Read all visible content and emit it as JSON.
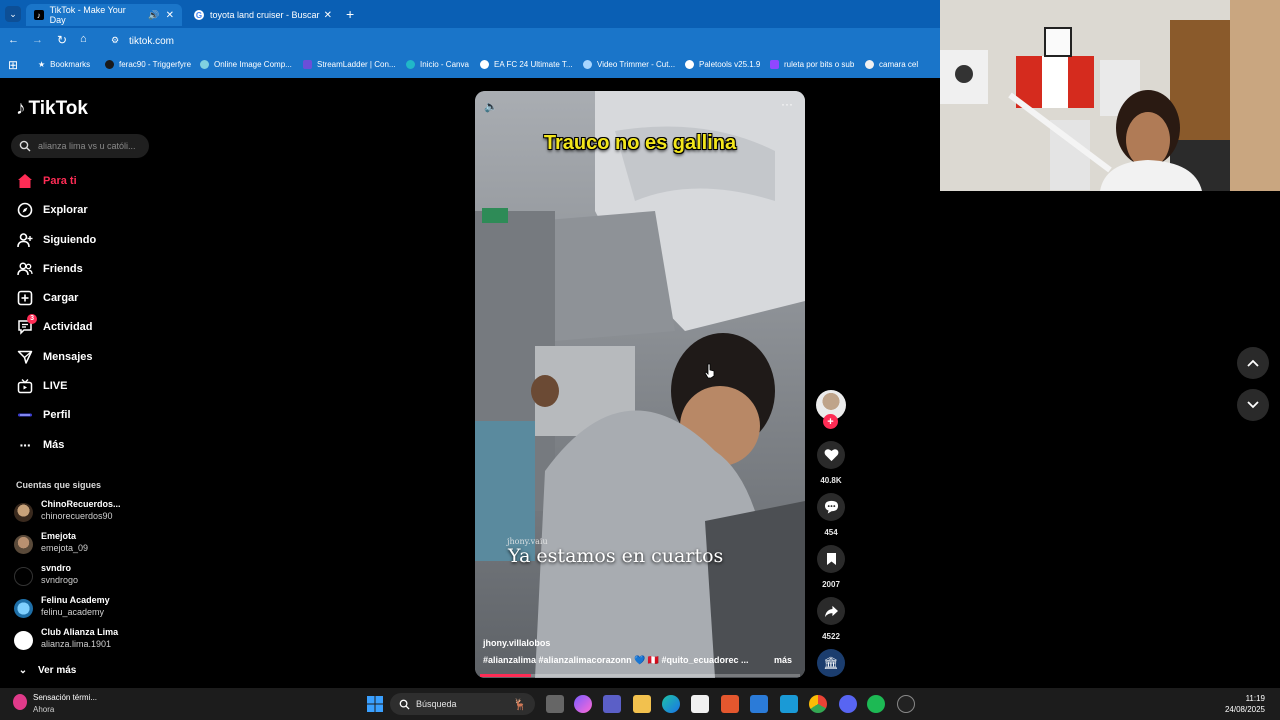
{
  "browser": {
    "tabs": [
      {
        "label": "TikTok - Make Your Day",
        "active": true
      },
      {
        "label": "toyota land cruiser - Buscar con",
        "active": false
      }
    ],
    "url": "tiktok.com",
    "bookmarks": [
      "Bookmarks",
      "ferac90 - Triggerfyre",
      "Online Image Comp...",
      "StreamLadder | Con...",
      "Inicio - Canva",
      "EA FC 24 Ultimate T...",
      "Video Trimmer - Cut...",
      "Paletools v25.1.9",
      "ruleta por bits o sub",
      "camara cel"
    ]
  },
  "sidebar": {
    "logo": "TikTok",
    "search_placeholder": "alianza lima vs u católi...",
    "nav": [
      {
        "label": "Para ti",
        "icon": "home-icon",
        "active": true
      },
      {
        "label": "Explorar",
        "icon": "compass-icon"
      },
      {
        "label": "Siguiendo",
        "icon": "following-icon"
      },
      {
        "label": "Friends",
        "icon": "friends-icon"
      },
      {
        "label": "Cargar",
        "icon": "upload-icon"
      },
      {
        "label": "Actividad",
        "icon": "activity-icon",
        "badge": "3"
      },
      {
        "label": "Mensajes",
        "icon": "messages-icon"
      },
      {
        "label": "LIVE",
        "icon": "live-icon"
      },
      {
        "label": "Perfil",
        "icon": "profile-icon"
      },
      {
        "label": "Más",
        "icon": "more-icon"
      }
    ],
    "following_title": "Cuentas que sigues",
    "accounts": [
      {
        "name": "ChinoRecuerdos...",
        "handle": "chinorecuerdos90"
      },
      {
        "name": "Emejota",
        "handle": "emejota_09"
      },
      {
        "name": "svndro",
        "handle": "svndrogo"
      },
      {
        "name": "Felinu Academy",
        "handle": "felinu_academy"
      },
      {
        "name": "Club Alianza Lima",
        "handle": "alianza.lima.1901"
      }
    ],
    "see_more": "Ver más"
  },
  "video": {
    "top_caption": "Trauco no es gallina",
    "watermark": "jhony.vaiu",
    "bottom_caption": "Ya estamos en cuartos",
    "author": "jhony.villalobos",
    "tags": "#alianzalima #alianzalimacorazonn 💙 🇵🇪 #quito_ecuadorec ...",
    "more": "más",
    "progress": 0.16
  },
  "actions": {
    "likes": "40.8K",
    "comments": "454",
    "saves": "2007",
    "shares": "4522"
  },
  "taskbar": {
    "weather_title": "Sensación térmi...",
    "weather_sub": "Ahora",
    "search_label": "Búsqueda",
    "time": "11:19",
    "date": "24/08/2025"
  },
  "colors": {
    "accent": "#fe2c55",
    "caption_yellow": "#f3e61c",
    "chrome_blue": "#1a75c9"
  }
}
